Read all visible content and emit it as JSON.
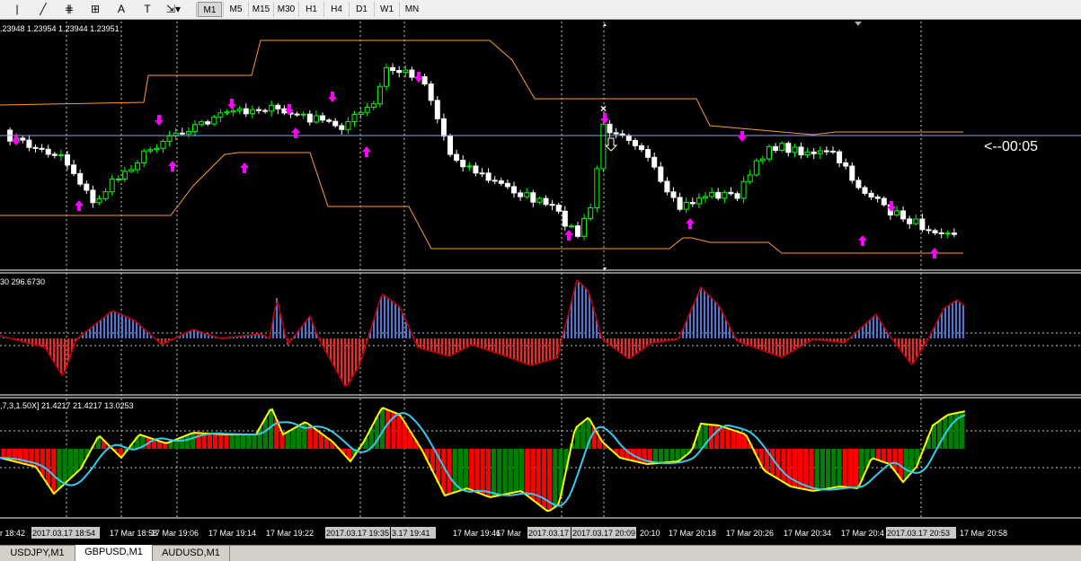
{
  "toolbar": {
    "tools": [
      {
        "icon": "vertical-line-icon",
        "glyph": "|"
      },
      {
        "icon": "trend-line-icon",
        "glyph": "╱"
      },
      {
        "icon": "fibonacci-icon",
        "glyph": "⋕"
      },
      {
        "icon": "fibonacci-fan-icon",
        "glyph": "⊞"
      },
      {
        "icon": "text-icon",
        "glyph": "A"
      },
      {
        "icon": "text-label-icon",
        "glyph": "T"
      },
      {
        "icon": "arrows-icon",
        "glyph": "⇲▾"
      }
    ],
    "timeframes": [
      "M1",
      "M5",
      "M15",
      "M30",
      "H1",
      "H4",
      "D1",
      "W1",
      "MN"
    ],
    "active_timeframe": "M1"
  },
  "panels": {
    "main_info": ".23948 1.23954 1.23944 1.23951",
    "osc1_info": "30 296.6730",
    "osc2_info": ",7,3,1.50X] 21.4217 21.4217 13.0253",
    "countdown": "<--00:05"
  },
  "time_axis": {
    "labels": [
      "r 18:42",
      "17 Mar 18:58",
      "17 Mar 19:06",
      "17 Mar 19:14",
      "17 Mar 19:22",
      "17 Mar 19:46",
      "17 Mar",
      "20:10",
      "17 Mar 20:18",
      "17 Mar 20:26",
      "17 Mar 20:34",
      "17 Mar 20:4",
      "17 Mar 20:58"
    ],
    "highlighted": [
      "2017.03.17 18:54",
      "2017.03.17 19:35",
      "3.17 19:41",
      "2017.03.17",
      "2017.03.17 20:09",
      "2017.03.17 20:53"
    ]
  },
  "tabs": [
    "USDJPY,M1",
    "GBPUSD,M1",
    "AUDUSD,M1"
  ],
  "active_tab": "GBPUSD,M1",
  "colors": {
    "bull_candle": "#00ff00",
    "bear_candle": "#ffffff",
    "band": "#ff9933",
    "signal_up": "#ff00ff",
    "hist_pos": "#4a78d8",
    "hist_neg": "#ff2020",
    "hist_line": "#c00000",
    "osc_green": "#008000",
    "osc_red": "#ff0000",
    "osc_fast": "#ffff00",
    "osc_slow": "#33ccee",
    "grid": "#c8c8c8",
    "price_line": "#7f9fff"
  },
  "chart_data": {
    "type": "line",
    "symbol": "GBPUSD",
    "timeframe": "M1",
    "last_close": 1.23951,
    "osc1_value": 296.673,
    "osc2_values": [
      21.4217,
      21.4217,
      13.0253
    ]
  }
}
